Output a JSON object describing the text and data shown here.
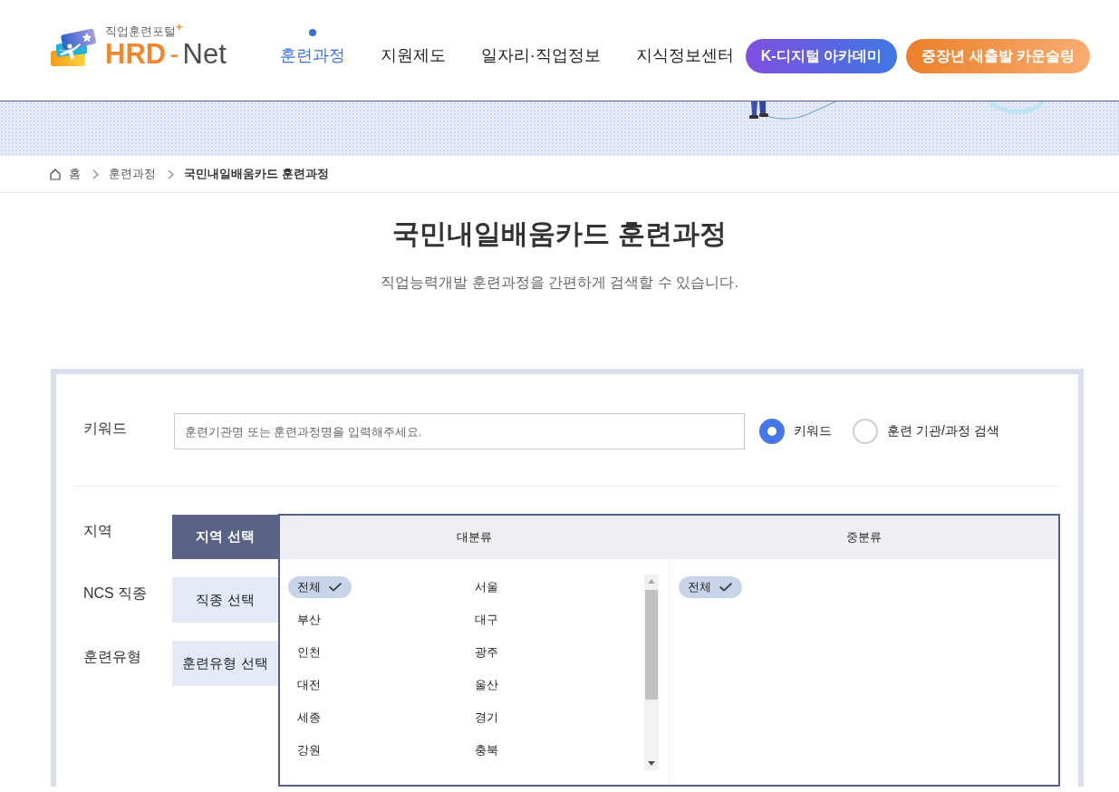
{
  "header": {
    "logo": {
      "tagline": "직업훈련포털$^{+}$",
      "wordmark": [
        "HRD",
        "-",
        "Net"
      ]
    },
    "nav": [
      {
        "label": "훈련과정",
        "selected": true
      },
      {
        "label": "지원제도",
        "selected": false
      },
      {
        "label": "일자리·직업정보",
        "selected": false
      },
      {
        "label": "지식정보센터",
        "selected": false
      }
    ],
    "promo_buttons": [
      {
        "label": "K-디지털 아카데미",
        "kind": "violet"
      },
      {
        "label": "중장년 새출발 카운슬링",
        "kind": "orange"
      }
    ]
  },
  "breadcrumb": [
    {
      "label": "홈",
      "kind": "home",
      "current": false
    },
    {
      "label": "훈련과정",
      "kind": "link",
      "current": false
    },
    {
      "label": "국민내일배움카드 훈련과정",
      "kind": "link",
      "current": true
    }
  ],
  "page": {
    "title": "국민내일배움카드 훈련과정",
    "subtitle": "직업능력개발 훈련과정을 간편하게 검색할 수 있습니다."
  },
  "search": {
    "keyword": {
      "label": "키워드",
      "placeholder": "훈련기관명 또는 훈련과정명을 입력해주세요.",
      "modes": [
        {
          "label": "키워드",
          "selected": true
        },
        {
          "label": "훈련 기관/과정 검색",
          "selected": false
        }
      ]
    },
    "filters": [
      {
        "label": "지역",
        "button": "지역 선택",
        "selected": true
      },
      {
        "label": "NCS 직종",
        "button": "직종 선택",
        "selected": false
      },
      {
        "label": "훈련유형",
        "button": "훈련유형 선택",
        "selected": false
      }
    ],
    "region_picker": {
      "columns": [
        {
          "title": "대분류",
          "scrollable": true,
          "items": [
            {
              "label": "전체",
              "selected": true
            },
            {
              "label": "서울",
              "selected": false
            },
            {
              "label": "부산",
              "selected": false
            },
            {
              "label": "대구",
              "selected": false
            },
            {
              "label": "인천",
              "selected": false
            },
            {
              "label": "광주",
              "selected": false
            },
            {
              "label": "대전",
              "selected": false
            },
            {
              "label": "울산",
              "selected": false
            },
            {
              "label": "세종",
              "selected": false
            },
            {
              "label": "경기",
              "selected": false
            },
            {
              "label": "강원",
              "selected": false
            },
            {
              "label": "충북",
              "selected": false
            }
          ]
        },
        {
          "title": "중분류",
          "scrollable": false,
          "items": [
            {
              "label": "전체",
              "selected": true
            }
          ]
        }
      ]
    }
  }
}
